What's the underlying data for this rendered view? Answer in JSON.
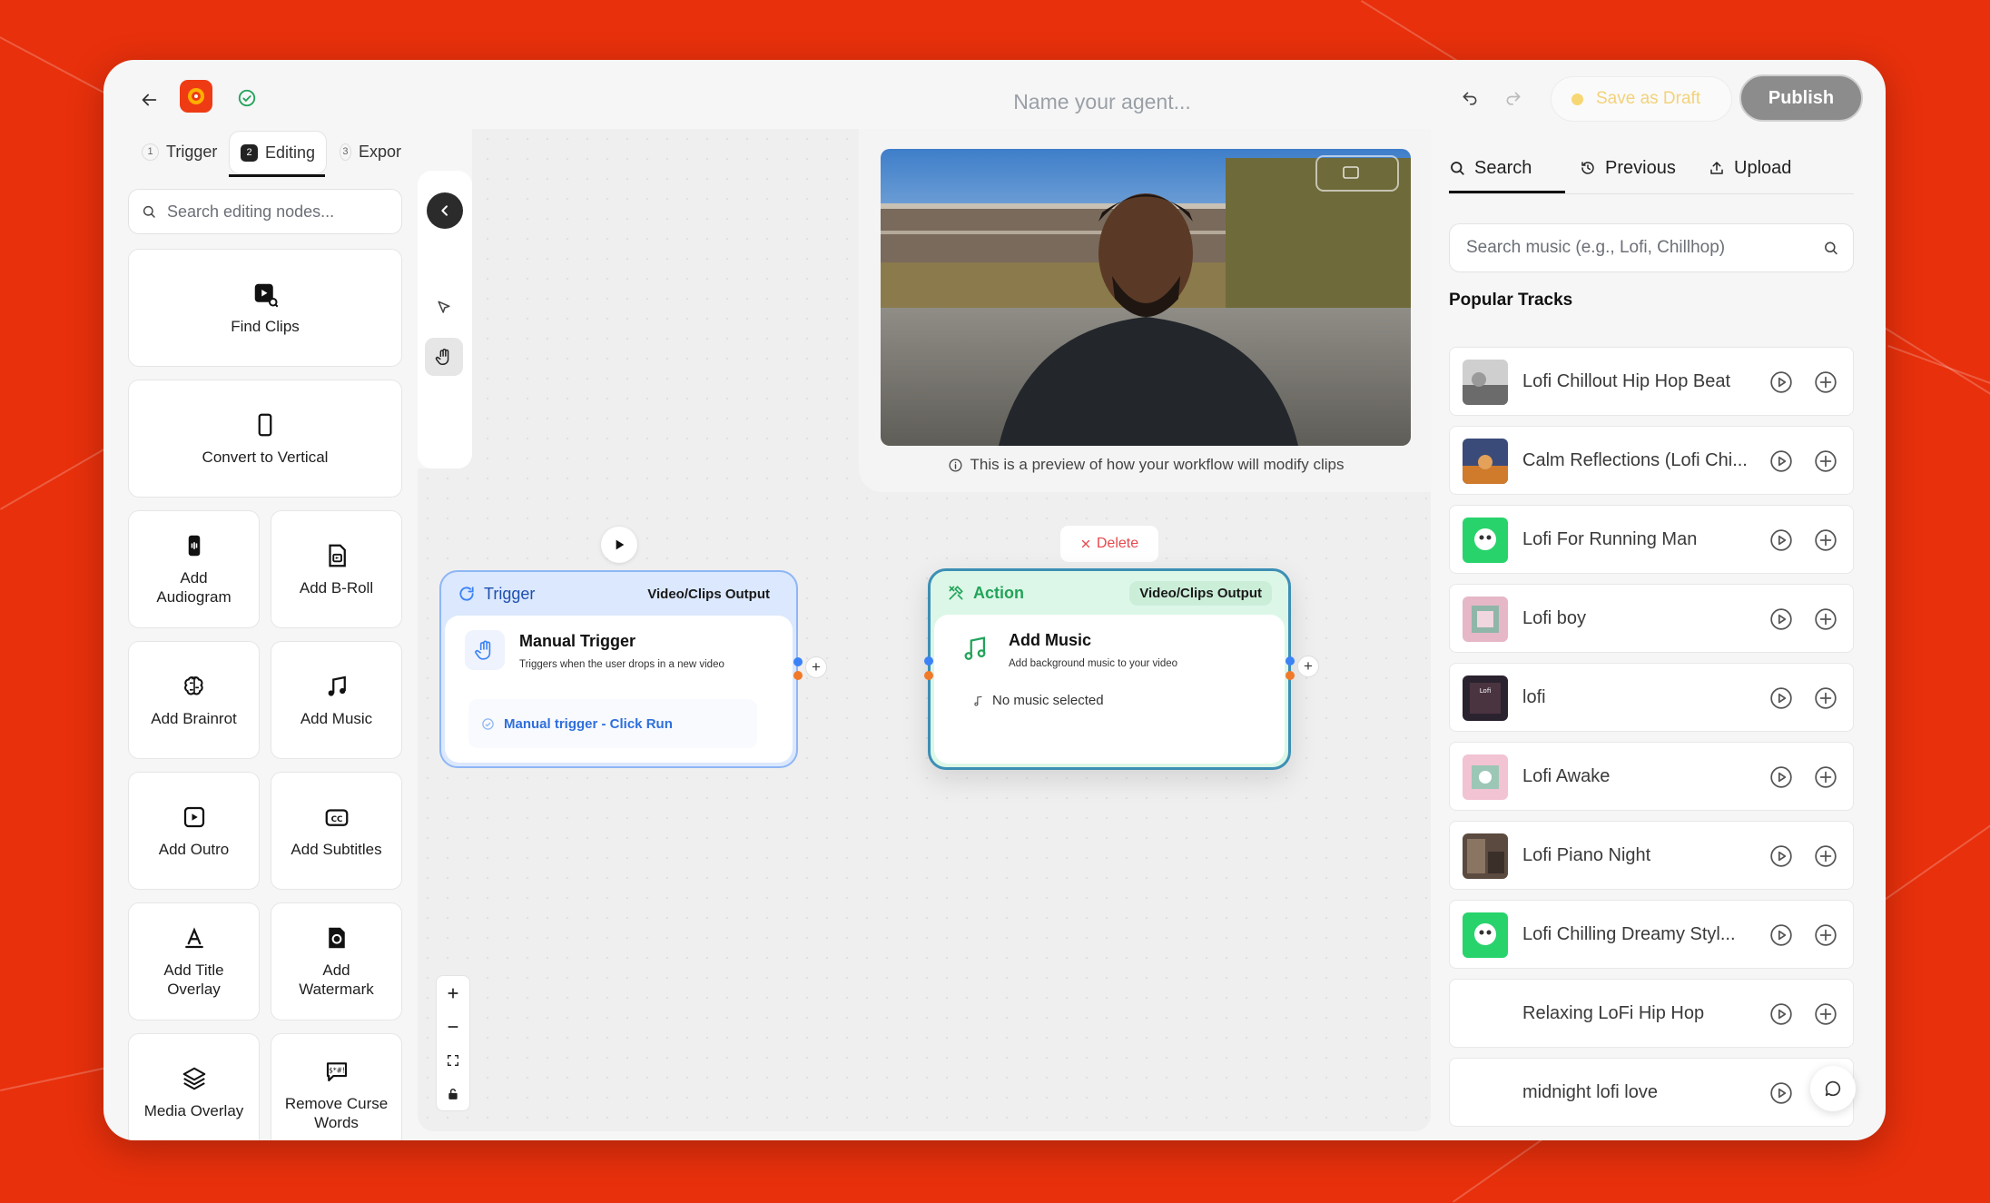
{
  "header": {
    "agent_name_placeholder": "Name your agent...",
    "save_draft_label": "Save as Draft",
    "publish_label": "Publish"
  },
  "steps": [
    {
      "num": "1",
      "label": "Trigger"
    },
    {
      "num": "2",
      "label": "Editing"
    },
    {
      "num": "3",
      "label": "Expor"
    }
  ],
  "left_panel": {
    "search_placeholder": "Search editing nodes...",
    "nodes": {
      "find_clips": "Find Clips",
      "convert_vertical": "Convert to Vertical",
      "add_audiogram": "Add\nAudiogram",
      "add_broll": "Add B-Roll",
      "add_brainrot": "Add Brainrot",
      "add_music": "Add Music",
      "add_outro": "Add Outro",
      "add_subtitles": "Add Subtitles",
      "add_title_overlay": "Add Title\nOverlay",
      "add_watermark": "Add\nWatermark",
      "media_overlay": "Media Overlay",
      "remove_curse": "Remove Curse\nWords"
    }
  },
  "preview": {
    "note": "This is a preview of how your workflow will modify clips"
  },
  "flow": {
    "delete_label": "Delete",
    "trigger": {
      "header": "Trigger",
      "output": "Video/Clips Output",
      "title": "Manual Trigger",
      "desc": "Triggers when the user drops in a new video",
      "run_label": "Manual trigger - Click Run"
    },
    "action": {
      "header": "Action",
      "output": "Video/Clips Output",
      "title": "Add Music",
      "desc": "Add background music to your video",
      "status": "No music selected"
    }
  },
  "right_panel": {
    "tabs": [
      "Search",
      "Previous",
      "Upload"
    ],
    "search_placeholder": "Search music (e.g., Lofi, Chillhop)",
    "popular_heading": "Popular Tracks",
    "tracks": [
      "Lofi Chillout Hip Hop Beat",
      "Calm Reflections (Lofi Chi...",
      "Lofi For Running Man",
      "Lofi boy",
      "lofi",
      "Lofi Awake",
      "Lofi Piano Night",
      "Lofi Chilling Dreamy Styl...",
      "Relaxing LoFi Hip Hop",
      "midnight lofi love"
    ]
  },
  "colors": {
    "background": "#e8300c",
    "trigger_blue": "#3b82f6",
    "action_green": "#22a35a",
    "publish_gray": "#8c8c8c",
    "delete_red": "#e5484d"
  }
}
